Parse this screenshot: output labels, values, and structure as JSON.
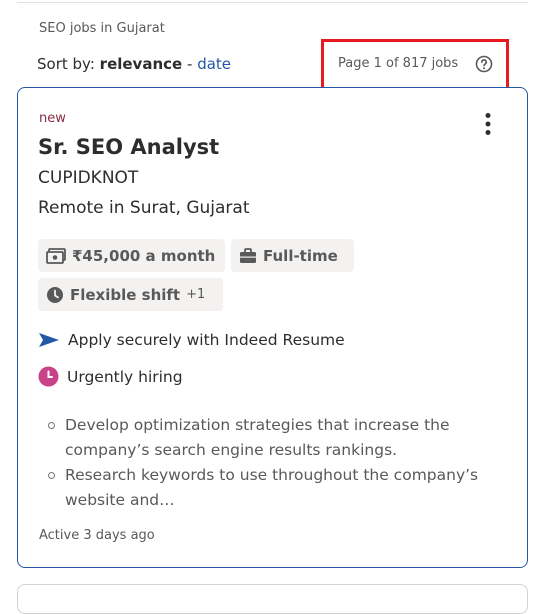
{
  "search": {
    "title": "SEO jobs in Gujarat"
  },
  "sort": {
    "prefix": "Sort by:",
    "active": "relevance",
    "separator": "-",
    "alt": "date"
  },
  "pagination": {
    "count_text": "Page 1 of 817 jobs",
    "help_icon": "question-circle-icon"
  },
  "colors": {
    "highlight": "#e8191f",
    "link": "#2557a7",
    "new": "#8a2b44",
    "urgent": "#c74289"
  },
  "job": {
    "badge": "new",
    "title": "Sr. SEO Analyst",
    "company": "CUPIDKNOT",
    "location": "Remote in Surat, Gujarat",
    "attributes": {
      "salary": "₹45,000 a month",
      "job_type": "Full-time",
      "shift": "Flexible shift",
      "shift_more": "+1"
    },
    "features": {
      "apply": "Apply securely with Indeed Resume",
      "urgent": "Urgently hiring"
    },
    "snippet": [
      "Develop optimization strategies that increase the company’s search engine results rankings.",
      "Research keywords to use throughout the company’s website and…"
    ],
    "posted": "Active 3 days ago"
  }
}
